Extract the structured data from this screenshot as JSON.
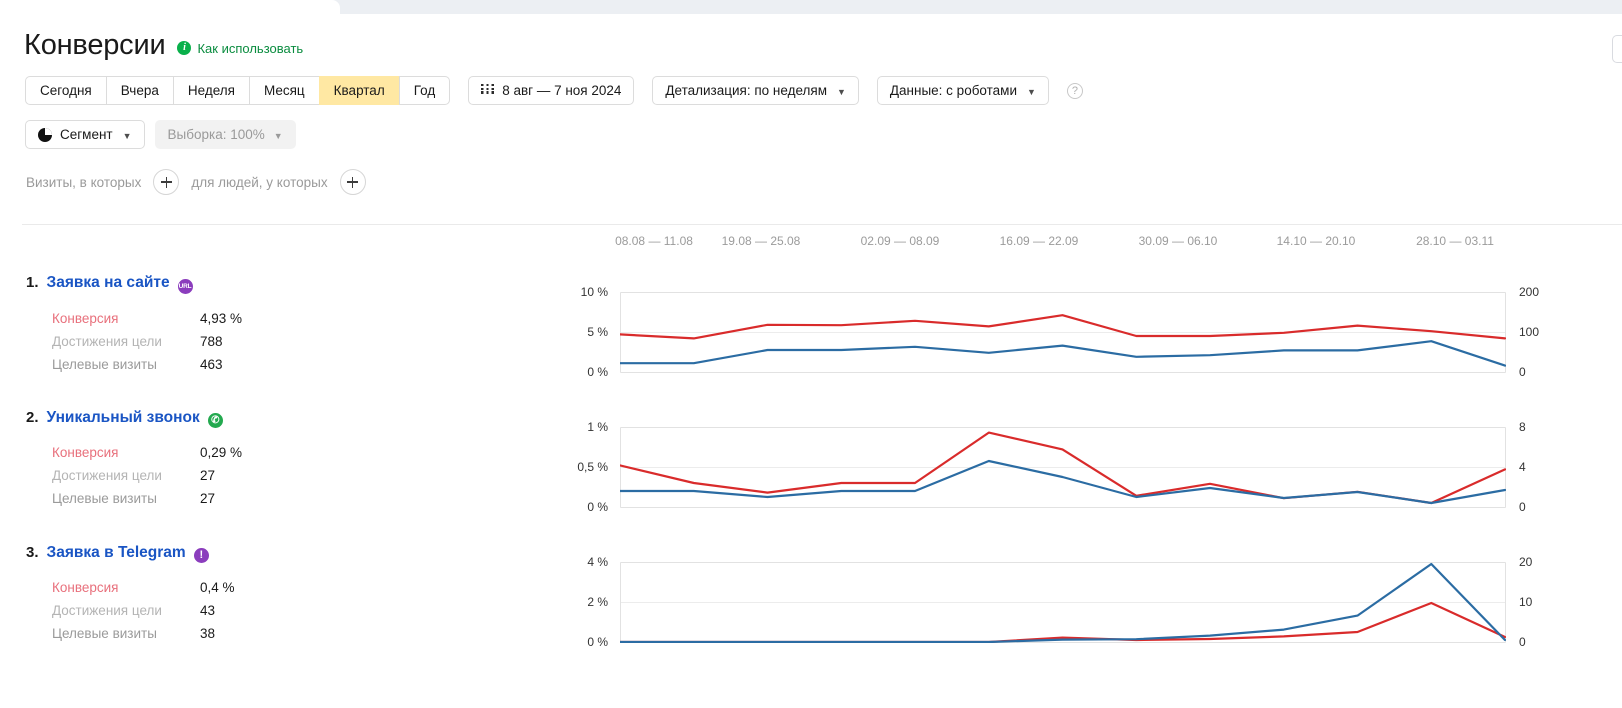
{
  "header": {
    "title": "Конверсии",
    "howto_label": "Как использовать",
    "info_icon": "info-icon"
  },
  "toolbar": {
    "periods": [
      {
        "label": "Сегодня",
        "active": false
      },
      {
        "label": "Вчера",
        "active": false
      },
      {
        "label": "Неделя",
        "active": false
      },
      {
        "label": "Месяц",
        "active": false
      },
      {
        "label": "Квартал",
        "active": true
      },
      {
        "label": "Год",
        "active": false
      }
    ],
    "date_range": "8 авг — 7 ноя 2024",
    "calendar_icon": "calendar-icon",
    "detail_select": "Детализация: по неделям",
    "data_select": "Данные: с роботами",
    "help_icon": "question-mark-icon"
  },
  "segment_row": {
    "segment_label": "Сегмент",
    "segment_icon": "pie-chart-icon",
    "sample_label": "Выборка: 100%"
  },
  "filter_row": {
    "visits_label": "Визиты, в которых",
    "people_label": "для людей, у которых",
    "add_icon": "plus-icon"
  },
  "metric_labels": {
    "conversion": "Конверсия",
    "goal_reaches": "Достижения цели",
    "target_visits": "Целевые визиты"
  },
  "colors": {
    "conversion_line": "#d92b2b",
    "visits_line": "#2b6ca3",
    "accent_yellow": "#ffe8a3",
    "link_blue": "#1a55c4",
    "green": "#0a8c3f"
  },
  "goals": [
    {
      "number": "1.",
      "name": "Заявка на сайте",
      "badge": "URL",
      "badge_kind": "url-badge-icon",
      "conversion": "4,93 %",
      "goal_reaches": "788",
      "target_visits": "463"
    },
    {
      "number": "2.",
      "name": "Уникальный звонок",
      "badge": "✆",
      "badge_kind": "phone-badge-icon",
      "conversion": "0,29 %",
      "goal_reaches": "27",
      "target_visits": "27"
    },
    {
      "number": "3.",
      "name": "Заявка в Telegram",
      "badge": "!",
      "badge_kind": "alert-badge-icon",
      "conversion": "0,4 %",
      "goal_reaches": "43",
      "target_visits": "38"
    }
  ],
  "chart_data": [
    {
      "type": "line",
      "title": "Заявка на сайте",
      "x": [
        "08.08 — 11.08",
        "19.08 — 25.08",
        "02.09 — 08.09",
        "16.09 — 22.09",
        "30.09 — 06.10",
        "14.10 — 20.10",
        "28.10 — 03.11"
      ],
      "xlabel": "",
      "ylabel": "%",
      "y2label": "",
      "ylim": [
        0,
        10
      ],
      "y2lim": [
        0,
        200
      ],
      "yticks": [
        "0 %",
        "5 %",
        "10 %"
      ],
      "y2ticks": [
        "0",
        "100",
        "200"
      ],
      "grid": true,
      "legend": "none",
      "series": [
        {
          "name": "Конверсия",
          "color": "#d92b2b",
          "axis": "left",
          "values": [
            4.7,
            4.2,
            5.9,
            5.85,
            6.4,
            5.7,
            7.1,
            4.5,
            4.5,
            4.9,
            5.8,
            5.1,
            4.2
          ]
        },
        {
          "name": "Целевые визиты",
          "color": "#2b6ca3",
          "axis": "right",
          "values": [
            22,
            22,
            55,
            55,
            63,
            48,
            66,
            38,
            42,
            54,
            54,
            77,
            16
          ]
        }
      ]
    },
    {
      "type": "line",
      "title": "Уникальный звонок",
      "x": [
        "08.08 — 11.08",
        "19.08 — 25.08",
        "02.09 — 08.09",
        "16.09 — 22.09",
        "30.09 — 06.10",
        "14.10 — 20.10",
        "28.10 — 03.11"
      ],
      "xlabel": "",
      "ylabel": "%",
      "y2label": "",
      "ylim": [
        0,
        1
      ],
      "y2lim": [
        0,
        8
      ],
      "yticks": [
        "0 %",
        "0,5 %",
        "1 %"
      ],
      "y2ticks": [
        "0",
        "4",
        "8"
      ],
      "grid": true,
      "legend": "none",
      "series": [
        {
          "name": "Конверсия",
          "color": "#d92b2b",
          "axis": "left",
          "values": [
            0.52,
            0.3,
            0.18,
            0.3,
            0.3,
            0.93,
            0.72,
            0.14,
            0.29,
            0.11,
            0.19,
            0.05,
            0.47
          ]
        },
        {
          "name": "Целевые визиты",
          "color": "#2b6ca3",
          "axis": "right",
          "values": [
            1.6,
            1.6,
            1.0,
            1.6,
            1.6,
            4.6,
            3.0,
            1.0,
            1.9,
            0.9,
            1.5,
            0.4,
            1.7
          ]
        }
      ]
    },
    {
      "type": "line",
      "title": "Заявка в Telegram",
      "x": [
        "08.08 — 11.08",
        "19.08 — 25.08",
        "02.09 — 08.09",
        "16.09 — 22.09",
        "30.09 — 06.10",
        "14.10 — 20.10",
        "28.10 — 03.11"
      ],
      "xlabel": "",
      "ylabel": "%",
      "y2label": "",
      "ylim": [
        0,
        4
      ],
      "y2lim": [
        0,
        20
      ],
      "yticks": [
        "0 %",
        "2 %",
        "4 %"
      ],
      "y2ticks": [
        "0",
        "10",
        "20"
      ],
      "grid": true,
      "legend": "none",
      "series": [
        {
          "name": "Конверсия",
          "color": "#d92b2b",
          "axis": "left",
          "values": [
            0,
            0,
            0,
            0,
            0,
            0,
            0.22,
            0.1,
            0.15,
            0.28,
            0.5,
            1.95,
            0.25
          ]
        },
        {
          "name": "Целевые визиты",
          "color": "#2b6ca3",
          "axis": "right",
          "values": [
            0,
            0,
            0,
            0,
            0,
            0,
            0.6,
            0.7,
            1.6,
            3.1,
            6.6,
            19.5,
            0.5
          ]
        }
      ]
    }
  ]
}
